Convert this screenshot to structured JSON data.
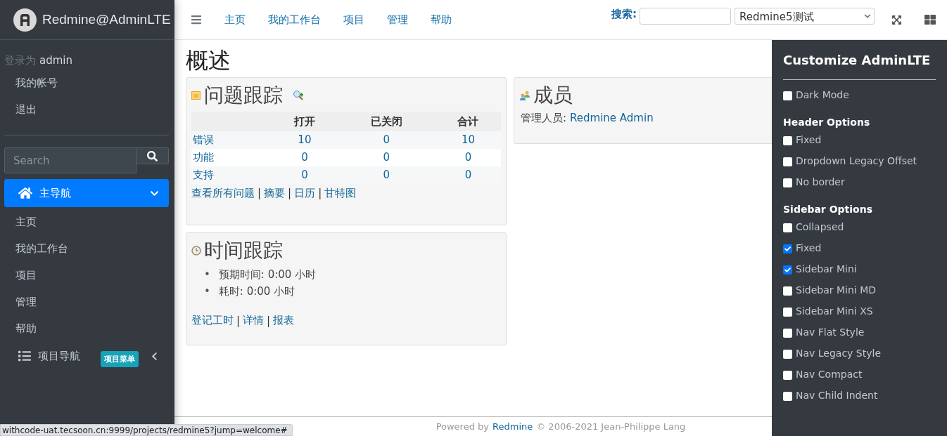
{
  "brand": {
    "title": "Redmine@AdminLTE"
  },
  "top_nav": {
    "items": [
      "主页",
      "我的工作台",
      "项目",
      "管理",
      "帮助"
    ]
  },
  "search": {
    "label": "搜索:",
    "project_select": "Redmine5测试"
  },
  "sidebar": {
    "login_label": "登录为",
    "user": "admin",
    "account_links": [
      "我的帐号",
      "退出"
    ],
    "search": {
      "placeholder": "Search"
    },
    "main_nav": {
      "label": "主导航",
      "expanded": true,
      "items": [
        "主页",
        "我的工作台",
        "项目",
        "管理",
        "帮助"
      ]
    },
    "project_nav": {
      "label": "项目导航",
      "badge": "项目菜单",
      "expanded": false
    }
  },
  "page_title": "概述",
  "issue_tracking": {
    "title": "问题跟踪",
    "columns": [
      "打开",
      "已关闭",
      "合计"
    ],
    "rows": [
      {
        "tracker": "错误",
        "cells": [
          "10",
          "0",
          "10"
        ]
      },
      {
        "tracker": "功能",
        "cells": [
          "0",
          "0",
          "0"
        ]
      },
      {
        "tracker": "支持",
        "cells": [
          "0",
          "0",
          "0"
        ]
      }
    ],
    "links": [
      "查看所有问题",
      "摘要",
      "日历",
      "甘特图"
    ],
    "separator": "|"
  },
  "time_tracking": {
    "title": "时间跟踪",
    "bullet": "•",
    "items": [
      "预期时间: 0:00 小时",
      "耗时: 0:00 小时"
    ],
    "links": [
      "登记工时",
      "详情",
      "报表"
    ],
    "separator": "|"
  },
  "members": {
    "title": "成员",
    "role": "管理人员:",
    "name": "Redmine Admin"
  },
  "footer": {
    "prefix": "Powered by",
    "link": "Redmine",
    "suffix": "© 2006-2021 Jean-Philippe Lang"
  },
  "control_sidebar": {
    "title": "Customize AdminLTE",
    "groups": [
      {
        "options": [
          {
            "label": "Dark Mode",
            "checked": false
          }
        ]
      },
      {
        "title": "Header Options",
        "options": [
          {
            "label": "Fixed",
            "checked": false
          },
          {
            "label": "Dropdown Legacy Offset",
            "checked": false
          },
          {
            "label": "No border",
            "checked": false
          }
        ]
      },
      {
        "title": "Sidebar Options",
        "options": [
          {
            "label": "Collapsed",
            "checked": false
          },
          {
            "label": "Fixed",
            "checked": true
          },
          {
            "label": "Sidebar Mini",
            "checked": true
          },
          {
            "label": "Sidebar Mini MD",
            "checked": false
          },
          {
            "label": "Sidebar Mini XS",
            "checked": false
          },
          {
            "label": "Nav Flat Style",
            "checked": false
          },
          {
            "label": "Nav Legacy Style",
            "checked": false
          },
          {
            "label": "Nav Compact",
            "checked": false
          },
          {
            "label": "Nav Child Indent",
            "checked": false
          }
        ]
      }
    ]
  },
  "status_bar": {
    "url": "withcode-uat.tecsoon.cn:9999/projects/redmine5?jump=welcome#"
  }
}
